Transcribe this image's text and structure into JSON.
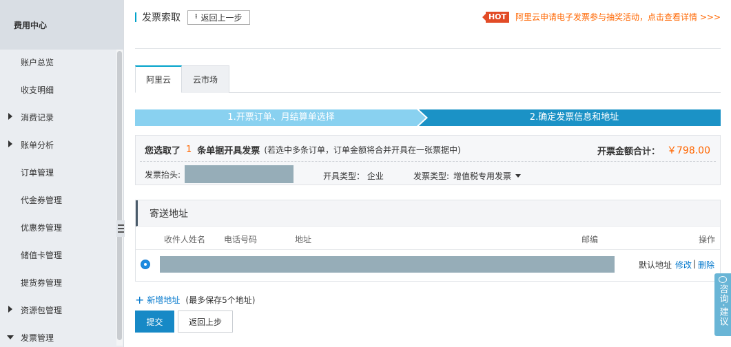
{
  "sidebar": {
    "title": "费用中心",
    "items": [
      {
        "label": "账户总览",
        "caret": "none"
      },
      {
        "label": "收支明细",
        "caret": "none"
      },
      {
        "label": "消费记录",
        "caret": "right"
      },
      {
        "label": "账单分析",
        "caret": "right"
      },
      {
        "label": "订单管理",
        "caret": "none"
      },
      {
        "label": "代金券管理",
        "caret": "none"
      },
      {
        "label": "优惠券管理",
        "caret": "none"
      },
      {
        "label": "储值卡管理",
        "caret": "none"
      },
      {
        "label": "提货券管理",
        "caret": "none"
      },
      {
        "label": "资源包管理",
        "caret": "right"
      },
      {
        "label": "发票管理",
        "caret": "down"
      }
    ]
  },
  "header": {
    "title": "发票索取",
    "back_label": "返回上一步",
    "back_icon": "up-arrow-icon",
    "promo_badge": "HOT",
    "promo_text": "阿里云申请电子发票参与抽奖活动，点击查看详情 >>>"
  },
  "tabs": [
    {
      "label": "阿里云",
      "active": true
    },
    {
      "label": "云市场",
      "active": false
    }
  ],
  "steps": [
    {
      "label": "1.开票订单、月结算单选择",
      "active": false
    },
    {
      "label": "2.确定发票信息和地址",
      "active": true
    }
  ],
  "summary": {
    "selected_prefix": "您选取了",
    "selected_count": "1",
    "selected_suffix": "条单据开具发票",
    "note": "(若选中多条订单，订单金额将合并开具在一张票据中)",
    "total_label": "开票金额合计：",
    "total_value": "￥798.00",
    "header_label": "发票抬头:",
    "issue_type": "开具类型：  企业",
    "invoice_type_label": "发票类型:",
    "invoice_type_value": "增值税专用发票"
  },
  "address": {
    "section_title": "寄送地址",
    "columns": [
      "收件人姓名",
      "电话号码",
      "地址",
      "邮编",
      "操作"
    ],
    "row": {
      "selected": true,
      "default_label": "默认地址",
      "edit_label": "修改",
      "separator": "|",
      "delete_label": "删除"
    },
    "add_label": "新增地址",
    "add_note": "(最多保存5个地址)"
  },
  "actions": {
    "submit_label": "提交",
    "back_label": "返回上步"
  },
  "feedback": {
    "label": "咨询·建议"
  },
  "colors": {
    "accent": "#00a2ca",
    "primary_button": "#1789c6",
    "price": "#ff6600",
    "link": "#0077cc",
    "step_inactive": "#89d1f0",
    "step_active": "#1b92c6"
  }
}
